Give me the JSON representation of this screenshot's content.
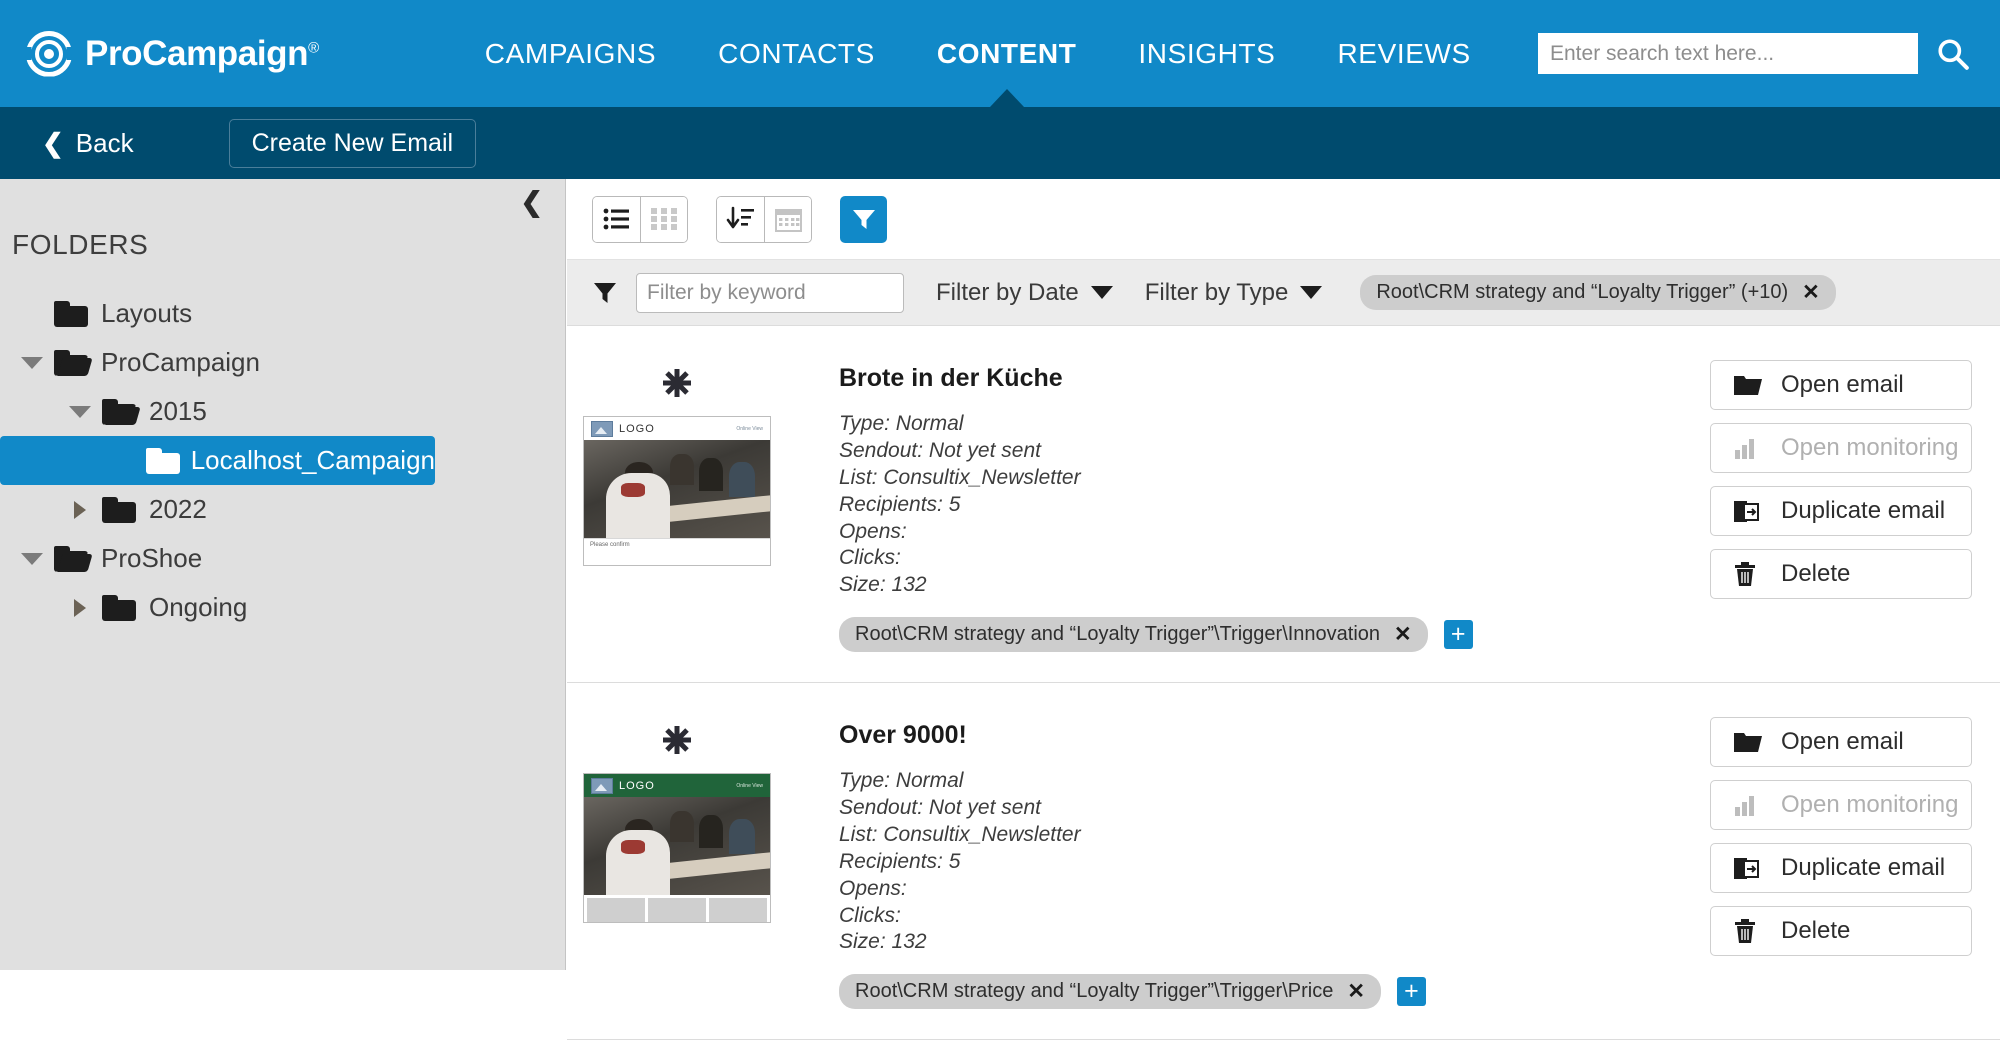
{
  "header": {
    "brand": "ProCampaign",
    "brand_registered": "®",
    "logo_icon": "target-circle-icon",
    "nav": [
      {
        "label": "CAMPAIGNS",
        "active": false
      },
      {
        "label": "CONTACTS",
        "active": false
      },
      {
        "label": "CONTENT",
        "active": true
      },
      {
        "label": "INSIGHTS",
        "active": false
      },
      {
        "label": "REVIEWS",
        "active": false
      }
    ],
    "search": {
      "placeholder": "Enter search text here...",
      "value": "",
      "icon": "search-icon"
    },
    "bg_color": "#1189c8"
  },
  "subbar": {
    "back_label": "Back",
    "back_icon": "chevron-left-icon",
    "create_label": "Create New Email",
    "bg_color": "#004b6e"
  },
  "sidebar": {
    "title": "FOLDERS",
    "collapse_icon": "chevron-left-icon",
    "tree": [
      {
        "label": "Layouts",
        "depth": 1,
        "twist": "none",
        "folder": "closed",
        "selected": false
      },
      {
        "label": "ProCampaign",
        "depth": 1,
        "twist": "down",
        "folder": "open",
        "selected": false
      },
      {
        "label": "2015",
        "depth": 2,
        "twist": "down",
        "folder": "open",
        "selected": false
      },
      {
        "label": "Localhost_Campaign",
        "depth": 3,
        "twist": "none",
        "folder": "closed",
        "selected": true
      },
      {
        "label": "2022",
        "depth": 2,
        "twist": "right",
        "folder": "closed",
        "selected": false
      },
      {
        "label": "ProShoe",
        "depth": 1,
        "twist": "down",
        "folder": "open",
        "selected": false
      },
      {
        "label": "Ongoing",
        "depth": 2,
        "twist": "right",
        "folder": "closed",
        "selected": false
      }
    ]
  },
  "toolbar": {
    "view_list_icon": "list-view-icon",
    "view_grid_icon": "grid-view-icon",
    "sort_icon": "sort-descending-icon",
    "calendar_icon": "calendar-icon",
    "filter_icon": "funnel-filter-icon",
    "filter_active_color": "#1189c8"
  },
  "filterbar": {
    "funnel_icon": "funnel-icon",
    "keyword_placeholder": "Filter by keyword",
    "keyword_value": "",
    "filter_by_date_label": "Filter by Date",
    "filter_by_type_label": "Filter by Type",
    "chevron_icon": "chevron-down-icon",
    "active_chip": {
      "label": "Root\\CRM strategy and “Loyalty Trigger” (+10)",
      "remove_icon": "close-x-icon"
    }
  },
  "emails": [
    {
      "title": "Brote in der Küche",
      "star_icon": "asterisk-icon",
      "thumbnail": {
        "logo_label": "LOGO",
        "online_view": "Online View",
        "header_color": "#ffffff",
        "image_icon": "image-placeholder-icon",
        "footer_text": "Please confirm"
      },
      "meta": [
        "Type: Normal",
        "Sendout: Not yet sent",
        "List: Consultix_Newsletter",
        "Recipients: 5",
        "Opens:",
        "Clicks:",
        "Size: 132"
      ],
      "tag": {
        "label": "Root\\CRM strategy and “Loyalty Trigger”\\Trigger\\Innovation",
        "remove_icon": "close-x-icon"
      },
      "add_tag_label": "+",
      "actions": [
        {
          "label": "Open email",
          "icon": "open-folder-icon",
          "disabled": false
        },
        {
          "label": "Open monitoring",
          "icon": "bar-chart-icon",
          "disabled": true
        },
        {
          "label": "Duplicate email",
          "icon": "duplicate-icon",
          "disabled": false
        },
        {
          "label": "Delete",
          "icon": "trash-icon",
          "disabled": false
        }
      ]
    },
    {
      "title": "Over 9000!",
      "star_icon": "asterisk-icon",
      "thumbnail": {
        "logo_label": "LOGO",
        "online_view": "Online View",
        "header_color": "#20643a",
        "image_icon": "image-placeholder-icon",
        "footer_text": ""
      },
      "meta": [
        "Type: Normal",
        "Sendout: Not yet sent",
        "List: Consultix_Newsletter",
        "Recipients: 5",
        "Opens:",
        "Clicks:",
        "Size: 132"
      ],
      "tag": {
        "label": "Root\\CRM strategy and “Loyalty Trigger”\\Trigger\\Price",
        "remove_icon": "close-x-icon"
      },
      "add_tag_label": "+",
      "actions": [
        {
          "label": "Open email",
          "icon": "open-folder-icon",
          "disabled": false
        },
        {
          "label": "Open monitoring",
          "icon": "bar-chart-icon",
          "disabled": true
        },
        {
          "label": "Duplicate email",
          "icon": "duplicate-icon",
          "disabled": false
        },
        {
          "label": "Delete",
          "icon": "trash-icon",
          "disabled": false
        }
      ]
    }
  ]
}
